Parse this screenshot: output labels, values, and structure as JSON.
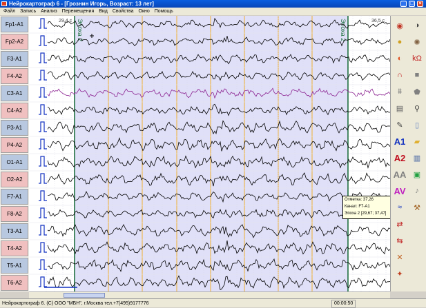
{
  "window": {
    "title": "Нейрокартограф 6 - [Грознин Игорь, Возраст: 13 лет]",
    "controls": {
      "minimize": "_",
      "maximize": "□",
      "close": "×"
    }
  },
  "menu": [
    "Файл",
    "Запись",
    "Анализ",
    "Перемещения",
    "Вид",
    "Свойства",
    "Окно",
    "Помощь"
  ],
  "channels": [
    {
      "label": "Fp1-A1",
      "color": "#b8c8e0"
    },
    {
      "label": "Fp2-A2",
      "color": "#f0c0c0"
    },
    {
      "label": "F3-A1",
      "color": "#b8c8e0"
    },
    {
      "label": "F4-A2",
      "color": "#f0c0c0"
    },
    {
      "label": "C3-A1",
      "color": "#b8c8e0"
    },
    {
      "label": "C4-A2",
      "color": "#f0c0c0"
    },
    {
      "label": "P3-A1",
      "color": "#b8c8e0"
    },
    {
      "label": "P4-A2",
      "color": "#f0c0c0"
    },
    {
      "label": "O1-A1",
      "color": "#b8c8e0"
    },
    {
      "label": "O2-A2",
      "color": "#f0c0c0"
    },
    {
      "label": "F7-A1",
      "color": "#b8c8e0"
    },
    {
      "label": "F8-A2",
      "color": "#f0c0c0"
    },
    {
      "label": "T3-A1",
      "color": "#b8c8e0"
    },
    {
      "label": "T4-A2",
      "color": "#f0c0c0"
    },
    {
      "label": "T5-A1",
      "color": "#b8c8e0"
    },
    {
      "label": "T6-A2",
      "color": "#f0c0c0"
    }
  ],
  "traces": {
    "default_color": "#000000",
    "highlight_channel": "C3-A1",
    "highlight_color": "#8a2090",
    "calibration_color": "#1030c0"
  },
  "epochs": [
    {
      "label": "Эпоха 2",
      "color": "#207040"
    },
    {
      "label": "Эпоха 2",
      "color": "#207040"
    }
  ],
  "time_markers": {
    "start": "29,4 с",
    "end": "36,5 с"
  },
  "selection_color": "#e0e0f8",
  "second_gridline_color": "#f0b030",
  "tooltip": {
    "lines": [
      "Отметка: 37,26",
      "Канал: F7-A1",
      "Эпоха 2 [29,67; 37,47]"
    ]
  },
  "toolbar": {
    "left_column": [
      {
        "icon": "compass-icon",
        "glyph": "◉",
        "color": "#c03020"
      },
      {
        "icon": "color-wheel-icon",
        "glyph": "●",
        "color": "#d0a020"
      },
      {
        "icon": "head-map-icon",
        "glyph": "◐",
        "color": "#e05020"
      },
      {
        "icon": "magnet-icon",
        "glyph": "∩",
        "color": "#c02020"
      },
      {
        "icon": "filter-icon",
        "glyph": "⩩",
        "color": "#808080"
      },
      {
        "icon": "notes-icon",
        "glyph": "▤",
        "color": "#606060"
      },
      {
        "icon": "pen-icon",
        "glyph": "✎",
        "color": "#404040"
      },
      {
        "text": "A1",
        "color": "#1030c0"
      },
      {
        "text": "A2",
        "color": "#c01020"
      },
      {
        "text": "AA",
        "color": "#808080"
      },
      {
        "text": "AV",
        "color": "#c020c0"
      },
      {
        "icon": "wave-icon",
        "glyph": "≈",
        "color": "#2040c0"
      },
      {
        "icon": "arrows-icon",
        "glyph": "⇄",
        "color": "#c02020"
      },
      {
        "icon": "swap-icon",
        "glyph": "⇆",
        "color": "#c02020"
      },
      {
        "icon": "measure-icon",
        "glyph": "✕",
        "color": "#c06020"
      },
      {
        "icon": "sparkle-icon",
        "glyph": "✦",
        "color": "#c04020"
      }
    ],
    "right_column": [
      {
        "icon": "sphere-icon",
        "glyph": "◑",
        "color": "#404040"
      },
      {
        "icon": "grid-sphere-icon",
        "glyph": "✺",
        "color": "#806040"
      },
      {
        "icon": "impedance-icon",
        "glyph": "kΩ",
        "color": "#c02020"
      },
      {
        "icon": "square-icon",
        "glyph": "■",
        "color": "#808080"
      },
      {
        "icon": "shield-icon",
        "glyph": "⬟",
        "color": "#808080"
      },
      {
        "icon": "search-icon",
        "glyph": "⚲",
        "color": "#404040"
      },
      {
        "icon": "document-icon",
        "glyph": "▯",
        "color": "#6080c0"
      },
      {
        "icon": "folder-icon",
        "glyph": "▰",
        "color": "#e0b030"
      },
      {
        "icon": "book-icon",
        "glyph": "▥",
        "color": "#4060a0"
      },
      {
        "icon": "save-icon",
        "glyph": "▣",
        "color": "#20a040"
      },
      {
        "icon": "sound-icon",
        "glyph": "♪",
        "color": "#808080"
      },
      {
        "icon": "tools-icon",
        "glyph": "⚒",
        "color": "#a06020"
      }
    ]
  },
  "status": {
    "text": "Нейрокартограф 6. (C) ООО \"МБН\", г.Москва тел.+7(495)9177776",
    "time": "00:00:50"
  }
}
